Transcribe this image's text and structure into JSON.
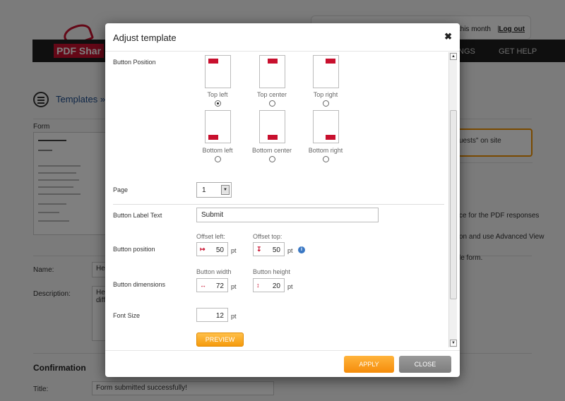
{
  "background": {
    "usage_text": "this month",
    "usage_separator": "|",
    "logout": "Log out",
    "logo": "PDF Shar",
    "nav": [
      "INGS",
      "GET HELP"
    ],
    "breadcrumb": "Templates »",
    "form_label": "Form",
    "name_label": "Name:",
    "name_value": "He",
    "description_label": "Description:",
    "description_value": "He\ndiff",
    "section_confirmation": "Confirmation",
    "title_label": "Title:",
    "title_value": "Form submitted successfully!",
    "right_box_text": "uests\" on site",
    "right_texts": [
      "ce for the PDF responses",
      "on and use Advanced View",
      "le form."
    ]
  },
  "modal": {
    "title": "Adjust template",
    "close_glyph": "✖",
    "button_position_label": "Button Position",
    "positions": [
      {
        "key": "top-left",
        "label": "Top left",
        "checked": true
      },
      {
        "key": "top-center",
        "label": "Top center",
        "checked": false
      },
      {
        "key": "top-right",
        "label": "Top right",
        "checked": false
      },
      {
        "key": "bottom-left",
        "label": "Bottom left",
        "checked": false
      },
      {
        "key": "bottom-center",
        "label": "Bottom center",
        "checked": false
      },
      {
        "key": "bottom-right",
        "label": "Bottom right",
        "checked": false
      }
    ],
    "page_label": "Page",
    "page_value": "1",
    "label_text_label": "Button Label Text",
    "label_text_value": "Submit",
    "button_position_row_label": "Button position",
    "offset_left_label": "Offset left:",
    "offset_left_value": "50",
    "offset_top_label": "Offset top:",
    "offset_top_value": "50",
    "dimensions_label": "Button dimensions",
    "width_label": "Button width",
    "width_value": "72",
    "height_label": "Button height",
    "height_value": "20",
    "font_size_label": "Font Size",
    "font_size_value": "12",
    "unit": "pt",
    "preview": "PREVIEW",
    "apply": "APPLY",
    "close": "CLOSE",
    "colors": {
      "accent": "#f59a0c",
      "marker": "#c8102e",
      "info": "#3a78c4"
    }
  }
}
